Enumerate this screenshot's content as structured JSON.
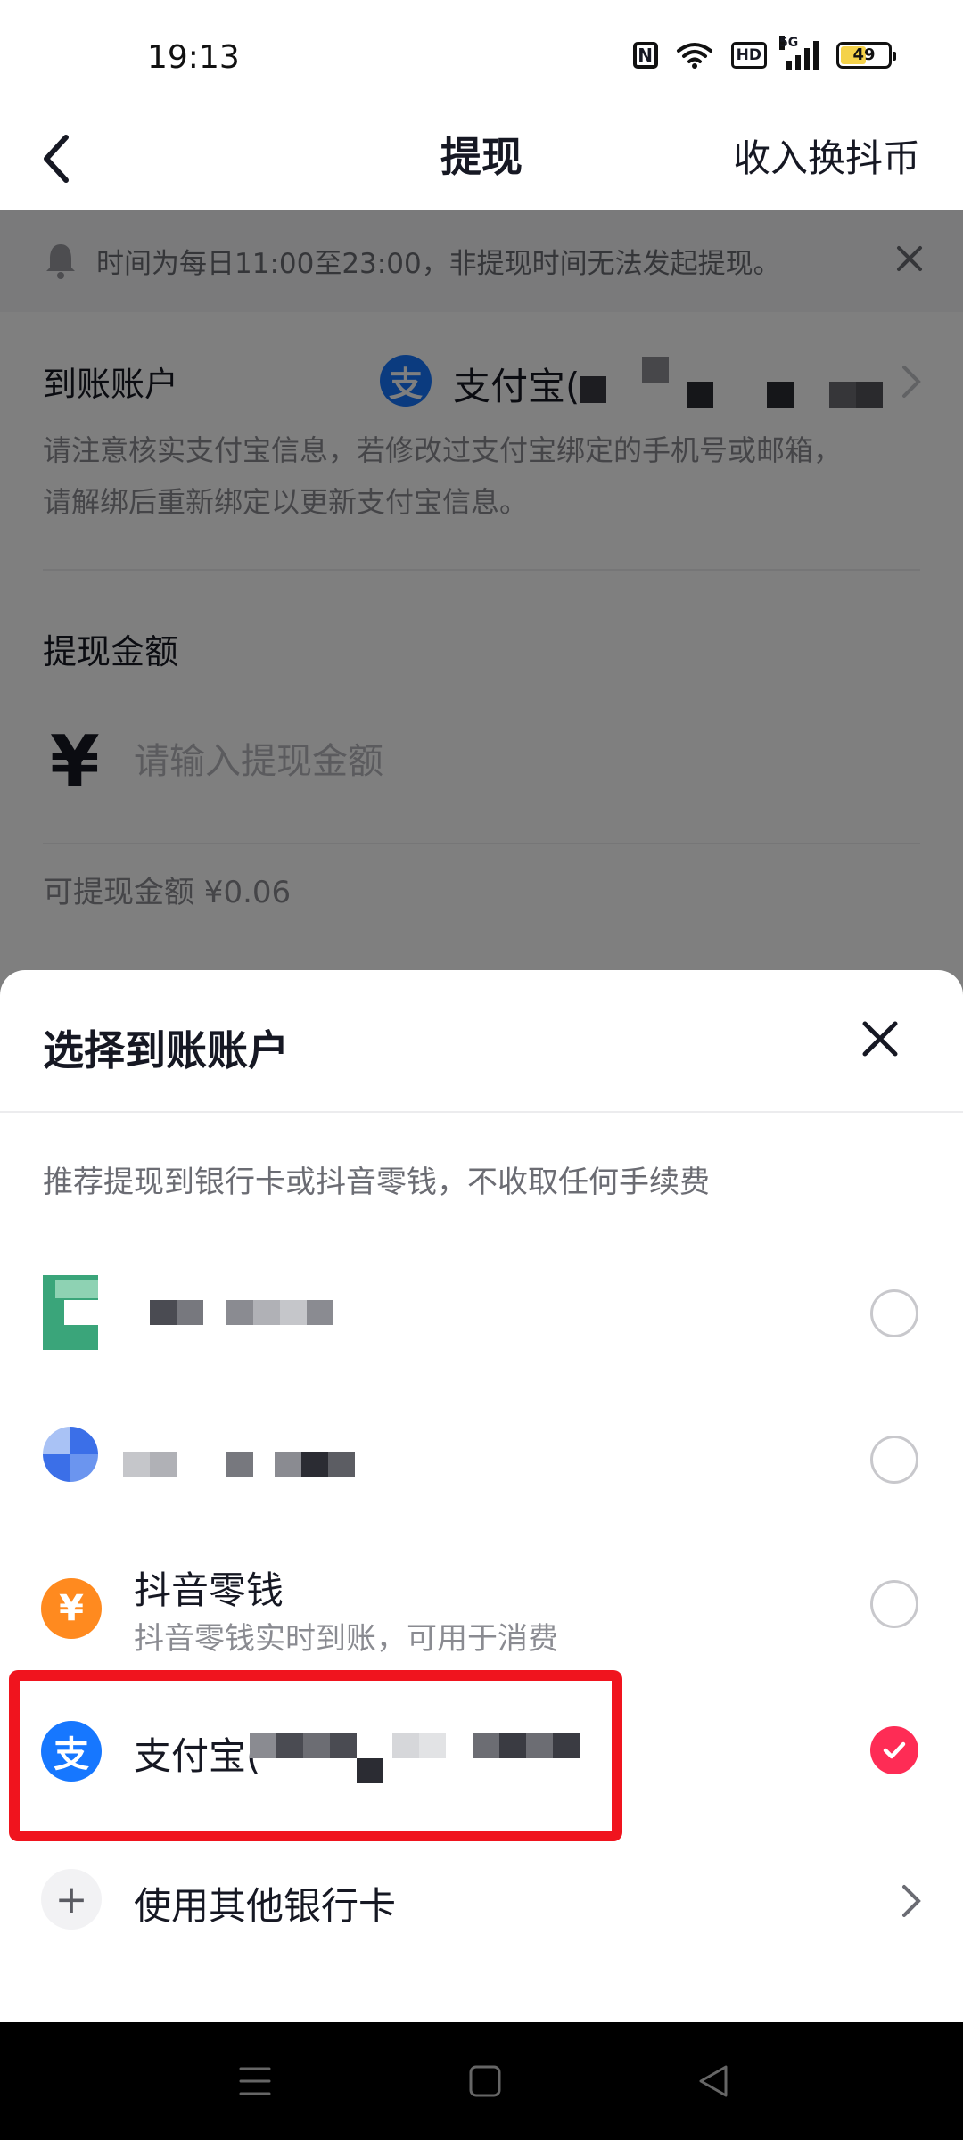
{
  "status_bar": {
    "time": "19:13",
    "nfc": "N",
    "hd": "HD",
    "network": "5G",
    "battery": "49"
  },
  "header": {
    "title": "提现",
    "right_action": "收入换抖币"
  },
  "notice": {
    "text": "时间为每日11:00至23:00，非提现时间无法发起提现。"
  },
  "account": {
    "label": "到账账户",
    "provider": "支付宝(",
    "provider_logo": "支",
    "hint_line1": "请注意核实支付宝信息，若修改过支付宝绑定的手机号或邮箱，",
    "hint_line2": "请解绑后重新绑定以更新支付宝信息。"
  },
  "amount": {
    "label": "提现金额",
    "currency_symbol": "¥",
    "placeholder": "请输入提现金额",
    "available": "可提现金额 ¥0.06"
  },
  "sheet": {
    "title": "选择到账账户",
    "tip": "推荐提现到银行卡或抖音零钱，不收取任何手续费",
    "options": [
      {
        "title": "",
        "selected": false,
        "accent": "#3aa57a"
      },
      {
        "title": "",
        "selected": false,
        "accent": "#3b6fe8"
      },
      {
        "title": "抖音零钱",
        "subtitle": "抖音零钱实时到账，可用于消费",
        "icon": "¥",
        "selected": false,
        "accent": "#ff8a1f"
      },
      {
        "title": "支付宝(",
        "icon": "支",
        "selected": true,
        "accent": "#1677ff"
      }
    ],
    "other_card": "使用其他银行卡",
    "plus": "+"
  }
}
